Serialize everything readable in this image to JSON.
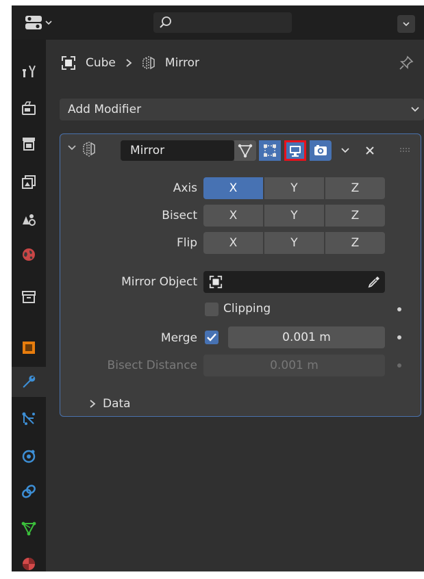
{
  "header": {
    "search_placeholder": "",
    "editor_type_icon": "properties-editor-icon"
  },
  "tabs": [
    {
      "name": "tool",
      "icon": "tool-icon"
    },
    {
      "name": "render",
      "icon": "render-icon"
    },
    {
      "name": "output",
      "icon": "output-icon"
    },
    {
      "name": "view-layer",
      "icon": "view-layer-icon"
    },
    {
      "name": "scene",
      "icon": "scene-icon"
    },
    {
      "name": "world",
      "icon": "world-icon"
    },
    {
      "name": "collection",
      "icon": "collection-icon"
    },
    {
      "name": "object",
      "icon": "object-icon"
    },
    {
      "name": "modifiers",
      "icon": "wrench-icon",
      "active": true
    },
    {
      "name": "particles",
      "icon": "particles-icon"
    },
    {
      "name": "physics",
      "icon": "physics-icon"
    },
    {
      "name": "constraints",
      "icon": "constraints-icon"
    },
    {
      "name": "data",
      "icon": "mesh-data-icon"
    },
    {
      "name": "material",
      "icon": "material-icon"
    }
  ],
  "breadcrumb": {
    "object": "Cube",
    "modifier": "Mirror"
  },
  "add_modifier": {
    "label": "Add Modifier"
  },
  "modifier": {
    "name": "Mirror",
    "axis": {
      "label": "Axis",
      "options": [
        "X",
        "Y",
        "Z"
      ],
      "active": [
        true,
        false,
        false
      ]
    },
    "bisect": {
      "label": "Bisect",
      "options": [
        "X",
        "Y",
        "Z"
      ],
      "active": [
        false,
        false,
        false
      ]
    },
    "flip": {
      "label": "Flip",
      "options": [
        "X",
        "Y",
        "Z"
      ],
      "active": [
        false,
        false,
        false
      ]
    },
    "mirror_object": {
      "label": "Mirror Object",
      "value": ""
    },
    "clipping": {
      "label": "Clipping",
      "checked": false
    },
    "merge": {
      "label": "Merge",
      "checked": true,
      "value": "0.001 m"
    },
    "bisect_distance": {
      "label": "Bisect Distance",
      "value": "0.001 m",
      "enabled": false
    },
    "data_section": {
      "label": "Data",
      "expanded": false
    }
  },
  "colors": {
    "accent_blue": "#4772b3",
    "highlight_red": "#e8121c",
    "panel_border": "#4a72ad"
  }
}
